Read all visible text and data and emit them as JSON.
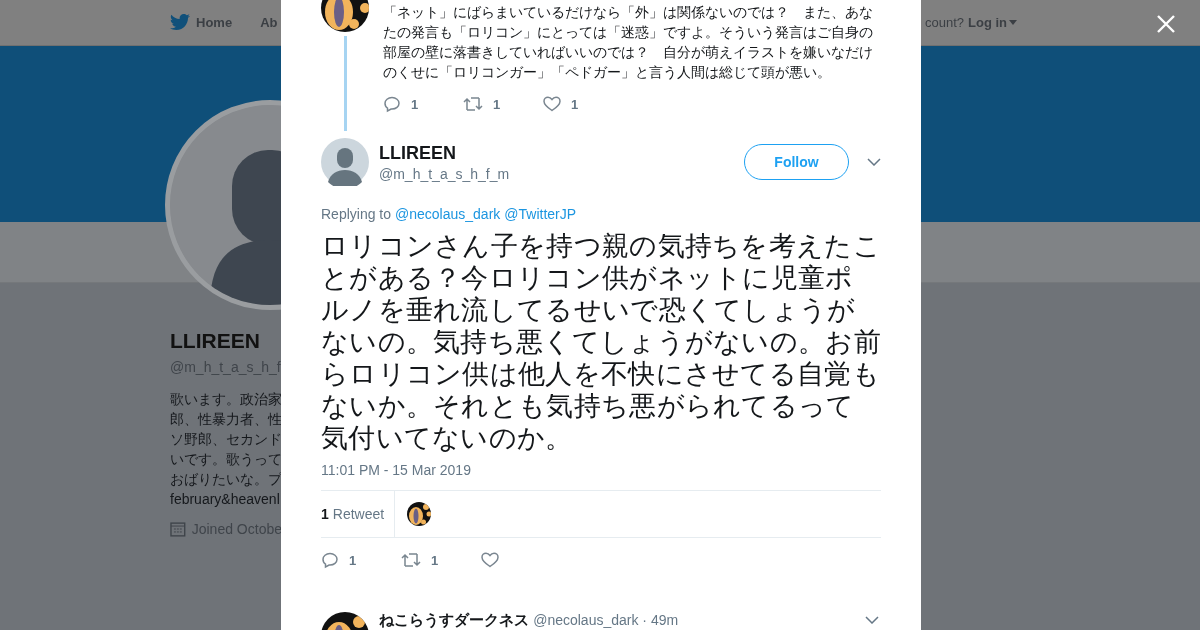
{
  "background_page": {
    "nav": {
      "items": [
        {
          "label": "Home",
          "kind": "home"
        },
        {
          "label": "Ab",
          "kind": "plain"
        }
      ],
      "account_prompt": "count?",
      "login": "Log in"
    },
    "profile": {
      "name": "LLIREEN",
      "handle": "@m_h_t_a_s_h_f",
      "bio_lines": [
        "歌います。政治家",
        "郎、性暴力者、性",
        "ソ野郎、セカンド",
        "いです。歌うって",
        "おばりたいな。プ"
      ],
      "bio_link": "february&heavenl",
      "joined": "Joined Octobe"
    }
  },
  "previous_tweet": {
    "text_lines": [
      "「ネット」にばらまいているだけなら「外」は関係ないのでは？　また、あな",
      "たの発言も「ロリコン」にとっては「迷惑」ですよ。そういう発言はご自身の",
      "部屋の壁に落書きしていればいいのでは？　自分が萌えイラストを嫌いなだけ",
      "のくせに「ロリコンガー」「ペドガー」と言う人間は総じて頭が悪い。"
    ],
    "actions": [
      {
        "kind": "reply",
        "count": "1"
      },
      {
        "kind": "retweet",
        "count": "1"
      },
      {
        "kind": "like",
        "count": "1"
      }
    ]
  },
  "tweet": {
    "name": "LLIREEN",
    "handle": "@m_h_t_a_s_h_f_m",
    "follow_label": "Follow",
    "replying_label": "Replying to",
    "reply_to": [
      "@necolaus_dark",
      "@TwitterJP"
    ],
    "text_lines": [
      "ロリコンさん子を持つ親の気持ちを考えたこ",
      "とがある？今ロリコン供がネットに児童ポ",
      "ルノを垂れ流してるせいで恐くてしょうが",
      "ないの。気持ち悪くてしょうがないの。お前",
      "らロリコン供は他人を不快にさせてる自覚も",
      "ないか。それとも気持ち悪がられてるって",
      "気付いてないのか。"
    ],
    "timestamp": "11:01 PM - 15 Mar 2019",
    "retweet_count": "1",
    "retweet_label": "Retweet",
    "actions": [
      {
        "kind": "reply",
        "count": "1"
      },
      {
        "kind": "retweet",
        "count": "1"
      },
      {
        "kind": "like"
      }
    ]
  },
  "next_tweet": {
    "name": "ねこらうすダークネス",
    "handle": "@necolaus_dark",
    "time": "· 49m"
  }
}
